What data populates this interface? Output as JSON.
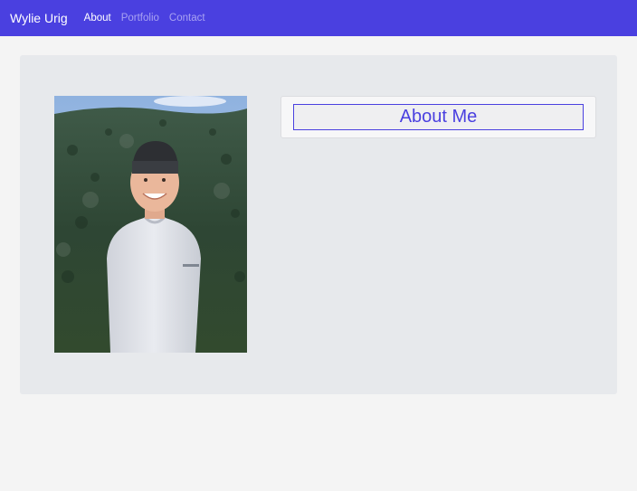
{
  "navbar": {
    "brand": "Wylie Urig",
    "links": [
      {
        "label": "About",
        "active": true
      },
      {
        "label": "Portfolio",
        "active": false
      },
      {
        "label": "Contact",
        "active": false
      }
    ]
  },
  "about": {
    "heading": "About Me"
  },
  "colors": {
    "accent": "#4a40e0",
    "page_bg": "#f4f4f4",
    "panel_bg": "#e7e9ec",
    "inactive_link": "#a9a2f2"
  }
}
